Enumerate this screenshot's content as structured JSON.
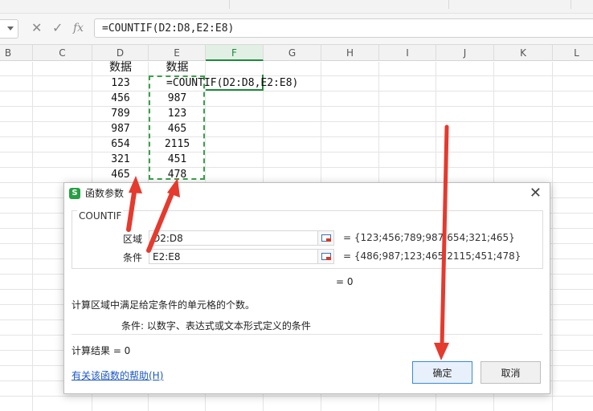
{
  "formula_bar": {
    "cancel_icon": "close-icon",
    "confirm_icon": "check-icon",
    "fx_label": "fx",
    "formula": "=COUNTIF(D2:D8,E2:E8)"
  },
  "columns": [
    "B",
    "C",
    "D",
    "E",
    "F",
    "G",
    "H",
    "I",
    "J",
    "K",
    "L"
  ],
  "active_column": "F",
  "sheet": {
    "d_header": "数据",
    "e_header": "数据",
    "d_values": [
      "123",
      "456",
      "789",
      "987",
      "654",
      "321",
      "465"
    ],
    "e_values": [
      "987",
      "123",
      "465",
      "2115",
      "451",
      "478"
    ],
    "f2_formula": "=COUNTIF(D2:D8,E2:E8)"
  },
  "dialog": {
    "title": "函数参数",
    "function_name": "COUNTIF",
    "args": [
      {
        "label": "区域",
        "value": "D2:D8",
        "preview": "= {123;456;789;987;654;321;465}"
      },
      {
        "label": "条件",
        "value": "E2:E8",
        "preview": "= {486;987;123;465;2115;451;478}"
      }
    ],
    "result_eq": "= 0",
    "description": "计算区域中满足给定条件的单元格的个数。",
    "param_desc": "条件:  以数字、表达式或文本形式定义的条件",
    "calc_result": "计算结果 = 0",
    "help_link": "有关该函数的帮助(H)",
    "ok_label": "确定",
    "cancel_label": "取消"
  },
  "colors": {
    "accent_green": "#1f8a3c",
    "range_dash": "#3aa04a",
    "annotation_red": "#e53a2e",
    "link_blue": "#1a56c4"
  }
}
